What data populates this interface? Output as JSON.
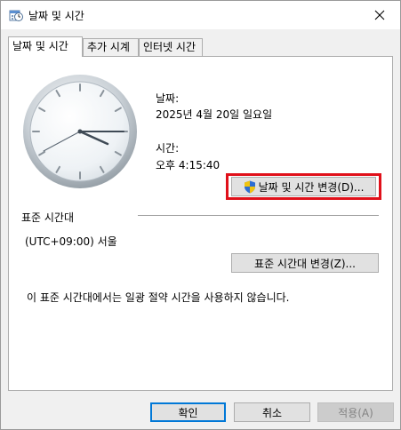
{
  "window": {
    "title": "날짜 및 시간"
  },
  "tabs": [
    {
      "label": "날짜 및 시간",
      "active": true
    },
    {
      "label": "추가 시계",
      "active": false
    },
    {
      "label": "인터넷 시간",
      "active": false
    }
  ],
  "date": {
    "label": "날짜:",
    "value": "2025년 4월 20일 일요일"
  },
  "time": {
    "label": "시간:",
    "value": "오후 4:15:40"
  },
  "change_datetime_button": "날짜 및 시간 변경(D)...",
  "timezone": {
    "section_label": "표준 시간대",
    "value": "(UTC+09:00) 서울",
    "change_button": "표준 시간대 변경(Z)...",
    "dst_note": "이 표준 시간대에서는 일광 절약 시간을 사용하지 않습니다."
  },
  "footer": {
    "ok": "확인",
    "cancel": "취소",
    "apply": "적용(A)"
  },
  "colors": {
    "highlight": "#e0101a",
    "accent": "#0078d7"
  }
}
